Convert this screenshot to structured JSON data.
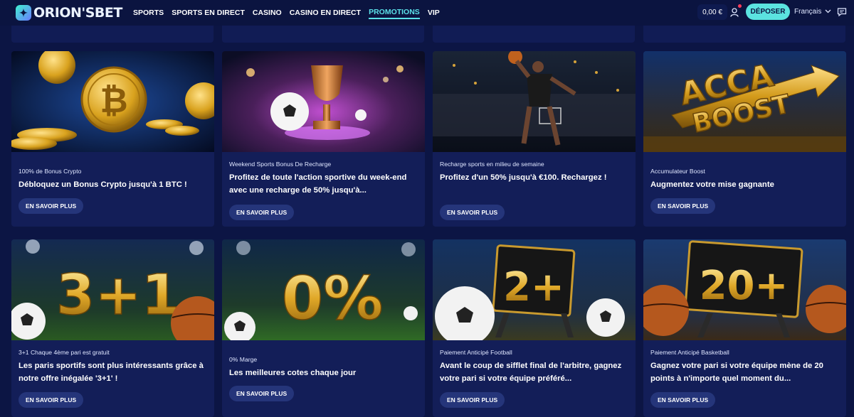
{
  "header": {
    "logo_text": "ORION'SBET",
    "nav": [
      "SPORTS",
      "SPORTS EN DIRECT",
      "CASINO",
      "CASINO EN DIRECT",
      "PROMOTIONS",
      "VIP"
    ],
    "balance": "0,00 €",
    "deposit_label": "DÉPOSER",
    "language": "Français"
  },
  "promotions": [
    {
      "category": "100% de Bonus Crypto",
      "title": "Débloquez un Bonus Crypto jusqu'à 1 BTC !",
      "button": "EN SAVOIR PLUS",
      "image": "crypto-coins"
    },
    {
      "category": "Weekend Sports Bonus De Recharge",
      "title": "Profitez de toute l'action sportive du week-end avec une recharge de 50% jusqu'à...",
      "button": "EN SAVOIR PLUS",
      "image": "trophy-football"
    },
    {
      "category": "Recharge sports en milieu de semaine",
      "title": "Profitez d'un 50% jusqu'à €100. Rechargez !",
      "button": "EN SAVOIR PLUS",
      "image": "basketball-player"
    },
    {
      "category": "Accumulateur Boost",
      "title": "Augmentez votre mise gagnante",
      "button": "EN SAVOIR PLUS",
      "image": "acca-boost"
    },
    {
      "category": "3+1 Chaque 4ème pari est gratuit",
      "title": "Les paris sportifs sont plus intéressants grâce à notre offre inégalée '3+1' !",
      "button": "EN SAVOIR PLUS",
      "image": "three-plus-one"
    },
    {
      "category": "0% Marge",
      "title": "Les meilleures cotes chaque jour",
      "button": "EN SAVOIR PLUS",
      "image": "zero-percent"
    },
    {
      "category": "Paiement Anticipé Football",
      "title": "Avant le coup de sifflet final de l'arbitre, gagnez votre pari si votre équipe préféré...",
      "button": "EN SAVOIR PLUS",
      "image": "two-plus"
    },
    {
      "category": "Paiement Anticipé Basketball",
      "title": "Gagnez votre pari si votre équipe mène de 20 points à n'importe quel moment du...",
      "button": "EN SAVOIR PLUS",
      "image": "twenty-plus"
    }
  ],
  "artwork": {
    "acca_line1": "ACCA",
    "acca_line2": "BOOST",
    "three_plus_one": "3+1",
    "zero_percent": "0%",
    "two_plus": "2+",
    "twenty_plus": "20+"
  }
}
